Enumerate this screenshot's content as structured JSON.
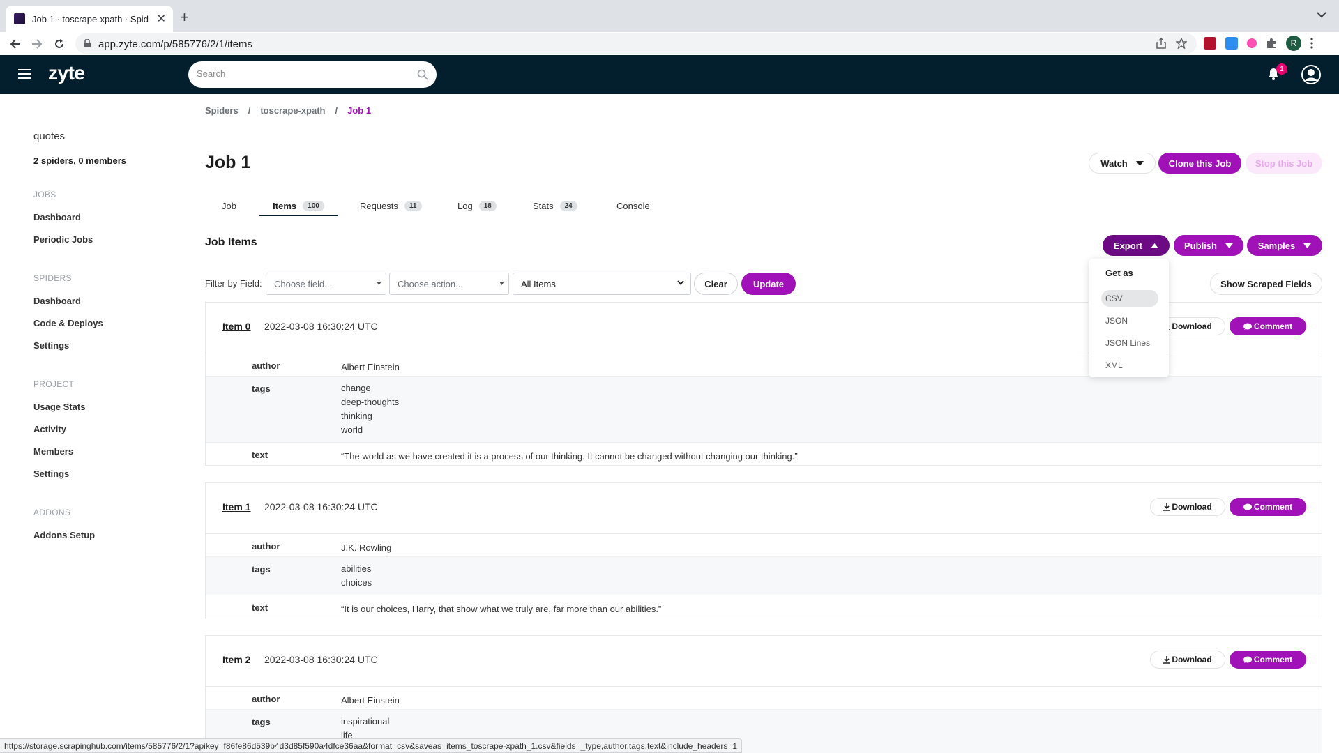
{
  "browser": {
    "tab_title": "Job 1 · toscrape-xpath · Spid",
    "url": "app.zyte.com/p/585776/2/1/items",
    "status_url": "https://storage.scrapinghub.com/items/585776/2/1?apikey=f86fe86d539b4d3d85f590a4dfce36aa&format=csv&saveas=items_toscrape-xpath_1.csv&fields=_type,author,tags,text&include_headers=1"
  },
  "header": {
    "logo": "zyte",
    "search_placeholder": "Search",
    "notification_count": "1"
  },
  "sidebar": {
    "org_name": "quotes",
    "spiders_link": "2 spiders",
    "members_link": "0 members",
    "sections": {
      "jobs": "JOBS",
      "spiders": "SPIDERS",
      "project": "PROJECT",
      "addons": "ADDONS"
    },
    "jobs_items": [
      "Dashboard",
      "Periodic Jobs"
    ],
    "spiders_items": [
      "Dashboard",
      "Code & Deploys",
      "Settings"
    ],
    "project_items": [
      "Usage Stats",
      "Activity",
      "Members",
      "Settings"
    ],
    "addons_items": [
      "Addons Setup"
    ]
  },
  "breadcrumb": [
    "Spiders",
    "toscrape-xpath",
    "Job 1"
  ],
  "page": {
    "title": "Job 1",
    "watch": "Watch",
    "clone": "Clone this Job",
    "stop": "Stop this Job"
  },
  "tabs": [
    {
      "label": "Job",
      "count": ""
    },
    {
      "label": "Items",
      "count": "100"
    },
    {
      "label": "Requests",
      "count": "11"
    },
    {
      "label": "Log",
      "count": "18"
    },
    {
      "label": "Stats",
      "count": "24"
    },
    {
      "label": "Console",
      "count": ""
    }
  ],
  "items_section": {
    "title": "Job Items",
    "export": "Export",
    "publish": "Publish",
    "samples": "Samples",
    "filter_label": "Filter by Field:",
    "choose_field": "Choose field...",
    "choose_action": "Choose action...",
    "all_items": "All Items",
    "clear": "Clear",
    "update": "Update",
    "show_fields": "Show Scraped Fields",
    "download": "Download",
    "comment": "Comment"
  },
  "export_menu": {
    "heading": "Get as",
    "options": [
      "CSV",
      "JSON",
      "JSON Lines",
      "XML"
    ],
    "highlighted": "CSV"
  },
  "items": [
    {
      "label": "Item 0",
      "timestamp": "2022-03-08 16:30:24 UTC",
      "author": "Albert Einstein",
      "tags": [
        "change",
        "deep-thoughts",
        "thinking",
        "world"
      ],
      "text": "“The world as we have created it is a process of our thinking. It cannot be changed without changing our thinking.”"
    },
    {
      "label": "Item 1",
      "timestamp": "2022-03-08 16:30:24 UTC",
      "author": "J.K. Rowling",
      "tags": [
        "abilities",
        "choices"
      ],
      "text": "“It is our choices, Harry, that show what we truly are, far more than our abilities.”"
    },
    {
      "label": "Item 2",
      "timestamp": "2022-03-08 16:30:24 UTC",
      "author": "Albert Einstein",
      "tags": [
        "inspirational",
        "life"
      ],
      "text": ""
    }
  ],
  "field_keys": {
    "author": "author",
    "tags": "tags",
    "text": "text"
  },
  "colors": {
    "brand": "#a012b8",
    "header_bg": "#031f2d",
    "export_active": "#6b0a83"
  }
}
